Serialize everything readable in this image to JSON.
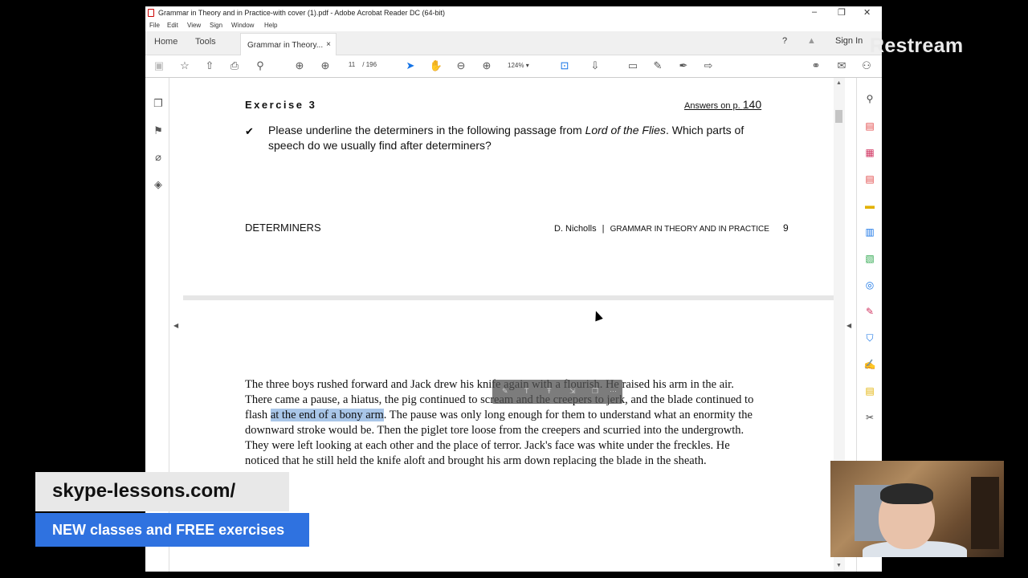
{
  "window": {
    "title": "Grammar in Theory and in Practice-with cover (1).pdf - Adobe Acrobat Reader DC (64-bit)",
    "controls": [
      "–",
      "❐",
      "✕"
    ]
  },
  "menu": [
    "File",
    "Edit",
    "View",
    "Sign",
    "Window",
    "Help"
  ],
  "tabs": {
    "home": "Home",
    "tools": "Tools",
    "document": "Grammar in Theory...",
    "close": "×",
    "sign_in": "Sign In"
  },
  "toolbar": {
    "current_page": "11",
    "separator": "/",
    "total_pages": "196",
    "zoom": "124%"
  },
  "page1": {
    "exercise_heading": "Exercise 3",
    "answers_prefix": "Answers on p. ",
    "answers_page": "140",
    "check": "✔",
    "instruction_before": "Please underline the determiners in the following passage from ",
    "instruction_title": "Lord of the Flies",
    "instruction_after": ". Which parts of speech do we usually find after determiners?",
    "footer_left": "DETERMINERS",
    "footer_author": "D. Nicholls",
    "footer_bar": "|",
    "footer_book": "Grammar in Theory and in Practice",
    "footer_page": "9"
  },
  "page2": {
    "passage_before": "The three boys rushed forward and Jack drew his knife again with a flourish. He raised his arm in the air. There came a pause, a hiatus, the pig continued to scream and the creepers to jerk, and the blade continued to flash ",
    "passage_highlight": "at the end of a bony arm",
    "passage_after": ". The pause was only long enough for them to understand what an enormity the downward stroke would be. Then the piglet tore loose from the creepers and scurried into the undergrowth. They were left looking at each other and the place of terror. Jack's face was white under the freckles. He noticed that he still held the knife aloft and brought his arm down replacing the blade in the sheath."
  },
  "overlay": {
    "restream": "Restream",
    "url": "skype-lessons.com/",
    "promo": "NEW classes and FREE exercises"
  },
  "colors": {
    "highlight": "#a9c6e8",
    "promo_blue": "#2f72e0",
    "acrobat_blue": "#1473e6"
  }
}
